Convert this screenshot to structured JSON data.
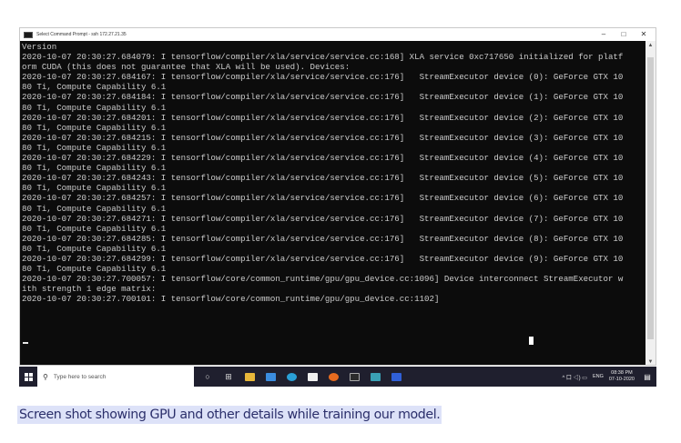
{
  "window": {
    "title": "Select Command Prompt - ssh 172.27.21.35",
    "controls": {
      "minimize": "–",
      "maximize": "□",
      "close": "✕"
    }
  },
  "console": {
    "lines": [
      "Version",
      "2020-10-07 20:30:27.684079: I tensorflow/compiler/xla/service/service.cc:168] XLA service 0xc717650 initialized for platf",
      "orm CUDA (this does not guarantee that XLA will be used). Devices:",
      "2020-10-07 20:30:27.684167: I tensorflow/compiler/xla/service/service.cc:176]   StreamExecutor device (0): GeForce GTX 10",
      "80 Ti, Compute Capability 6.1",
      "2020-10-07 20:30:27.684184: I tensorflow/compiler/xla/service/service.cc:176]   StreamExecutor device (1): GeForce GTX 10",
      "80 Ti, Compute Capability 6.1",
      "2020-10-07 20:30:27.684201: I tensorflow/compiler/xla/service/service.cc:176]   StreamExecutor device (2): GeForce GTX 10",
      "80 Ti, Compute Capability 6.1",
      "2020-10-07 20:30:27.684215: I tensorflow/compiler/xla/service/service.cc:176]   StreamExecutor device (3): GeForce GTX 10",
      "80 Ti, Compute Capability 6.1",
      "2020-10-07 20:30:27.684229: I tensorflow/compiler/xla/service/service.cc:176]   StreamExecutor device (4): GeForce GTX 10",
      "80 Ti, Compute Capability 6.1",
      "2020-10-07 20:30:27.684243: I tensorflow/compiler/xla/service/service.cc:176]   StreamExecutor device (5): GeForce GTX 10",
      "80 Ti, Compute Capability 6.1",
      "2020-10-07 20:30:27.684257: I tensorflow/compiler/xla/service/service.cc:176]   StreamExecutor device (6): GeForce GTX 10",
      "80 Ti, Compute Capability 6.1",
      "2020-10-07 20:30:27.684271: I tensorflow/compiler/xla/service/service.cc:176]   StreamExecutor device (7): GeForce GTX 10",
      "80 Ti, Compute Capability 6.1",
      "2020-10-07 20:30:27.684285: I tensorflow/compiler/xla/service/service.cc:176]   StreamExecutor device (8): GeForce GTX 10",
      "80 Ti, Compute Capability 6.1",
      "2020-10-07 20:30:27.684299: I tensorflow/compiler/xla/service/service.cc:176]   StreamExecutor device (9): GeForce GTX 10",
      "80 Ti, Compute Capability 6.1",
      "2020-10-07 20:30:27.700057: I tensorflow/core/common_runtime/gpu/gpu_device.cc:1096] Device interconnect StreamExecutor w",
      "ith strength 1 edge matrix:",
      "2020-10-07 20:30:27.700101: I tensorflow/core/common_runtime/gpu/gpu_device.cc:1102]"
    ]
  },
  "taskbar": {
    "search_placeholder": "Type here to search",
    "icons": [
      "task-view-icon",
      "file-explorer-icon",
      "store-icon",
      "edge-icon",
      "lock-app-icon",
      "firefox-icon",
      "terminal-icon",
      "app-icon",
      "security-icon"
    ],
    "tray": {
      "icons_text": "^ 口 ◁) ▭",
      "language": "ENG",
      "time": "08:38 PM",
      "date": "07-10-2020"
    }
  },
  "caption": "Screen shot showing GPU and other details while training our model.",
  "colors": {
    "console_bg": "#0c0c0c",
    "console_text": "#cccccc",
    "taskbar_bg": "#1f1f2e",
    "caption_highlight": "#dde2f8",
    "caption_text": "#2b2f6b"
  }
}
